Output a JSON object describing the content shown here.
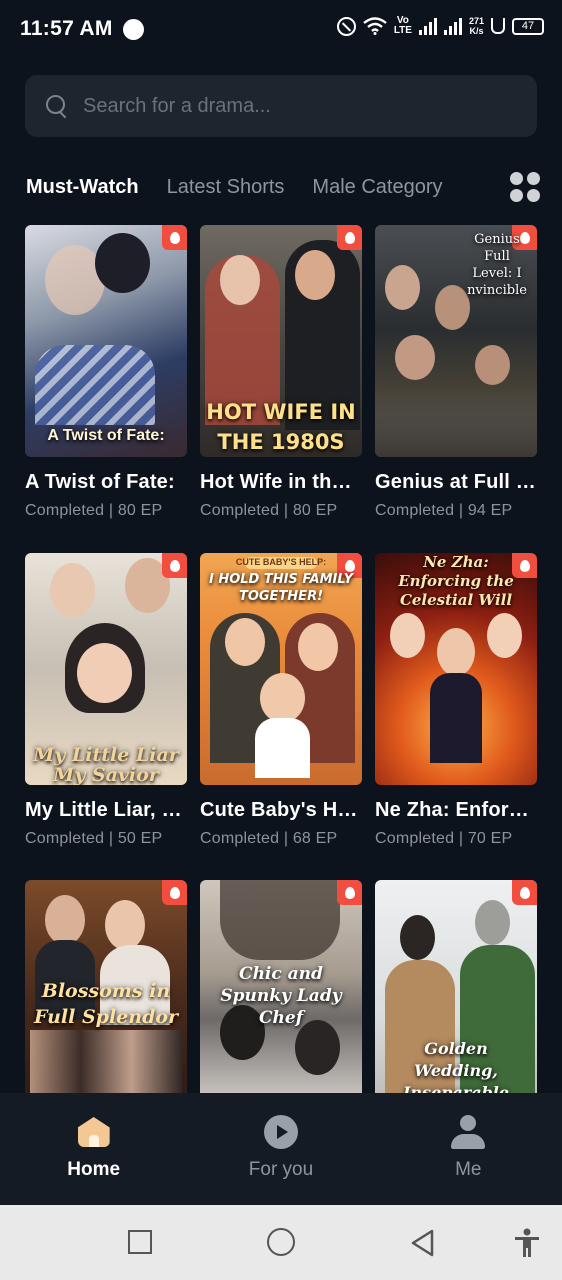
{
  "status_bar": {
    "time": "11:57 AM",
    "volte_top": "Vo",
    "volte_bottom": "LTE",
    "speed_value": "271",
    "speed_unit": "K/s",
    "battery": "47"
  },
  "search": {
    "placeholder": "Search for a drama..."
  },
  "tabs": [
    {
      "label": "Must-Watch",
      "active": true
    },
    {
      "label": "Latest Shorts",
      "active": false
    },
    {
      "label": "Male Category",
      "active": false
    }
  ],
  "dramas": [
    {
      "title": "A Twist of Fate:",
      "poster_text": "A Twist of Fate:",
      "meta": "Completed | 80 EP",
      "hot": true
    },
    {
      "title": "Hot Wife in the 1980s",
      "poster_text": "HOT WIFE IN THE 1980S",
      "meta": "Completed | 80 EP",
      "hot": true
    },
    {
      "title": "Genius at Full Level: I nvincible",
      "poster_text": "Genius Full Level: I nvincible",
      "meta": "Completed | 94 EP",
      "hot": true
    },
    {
      "title": "My Little Liar, My Savior",
      "poster_text": "My Little Liar My Savior",
      "meta": "Completed | 50 EP",
      "hot": true
    },
    {
      "title": "Cute Baby's Help: I Hold This Family Together!",
      "poster_text": "I HOLD THIS FAMILY TOGETHER!",
      "poster_subtext": "CUTE BABY'S HELP:",
      "meta": "Completed | 68 EP",
      "hot": true
    },
    {
      "title": "Ne Zha: Enforcing the Celestial Will",
      "poster_text": "Ne Zha: Enforcing the Celestial Will",
      "meta": "Completed | 70 EP",
      "hot": true
    },
    {
      "title": "Blossoms in Full Splendor",
      "poster_text": "Blossoms in Full Splendor",
      "hot": true
    },
    {
      "title": "Chic and Spunky Lady Chef",
      "poster_text": "Chic and Spunky Lady Chef",
      "hot": true
    },
    {
      "title": "Golden Wedding, Inseparable",
      "poster_text": "Golden Wedding, Inseparable",
      "hot": true
    }
  ],
  "bottom_nav": [
    {
      "label": "Home",
      "icon": "home-icon",
      "active": true
    },
    {
      "label": "For you",
      "icon": "play-icon",
      "active": false
    },
    {
      "label": "Me",
      "icon": "person-icon",
      "active": false
    }
  ],
  "colors": {
    "background": "#0d131c",
    "search_bg": "#1e252f",
    "hot_badge": "#f24e3f",
    "home_active": "#f4c894"
  }
}
